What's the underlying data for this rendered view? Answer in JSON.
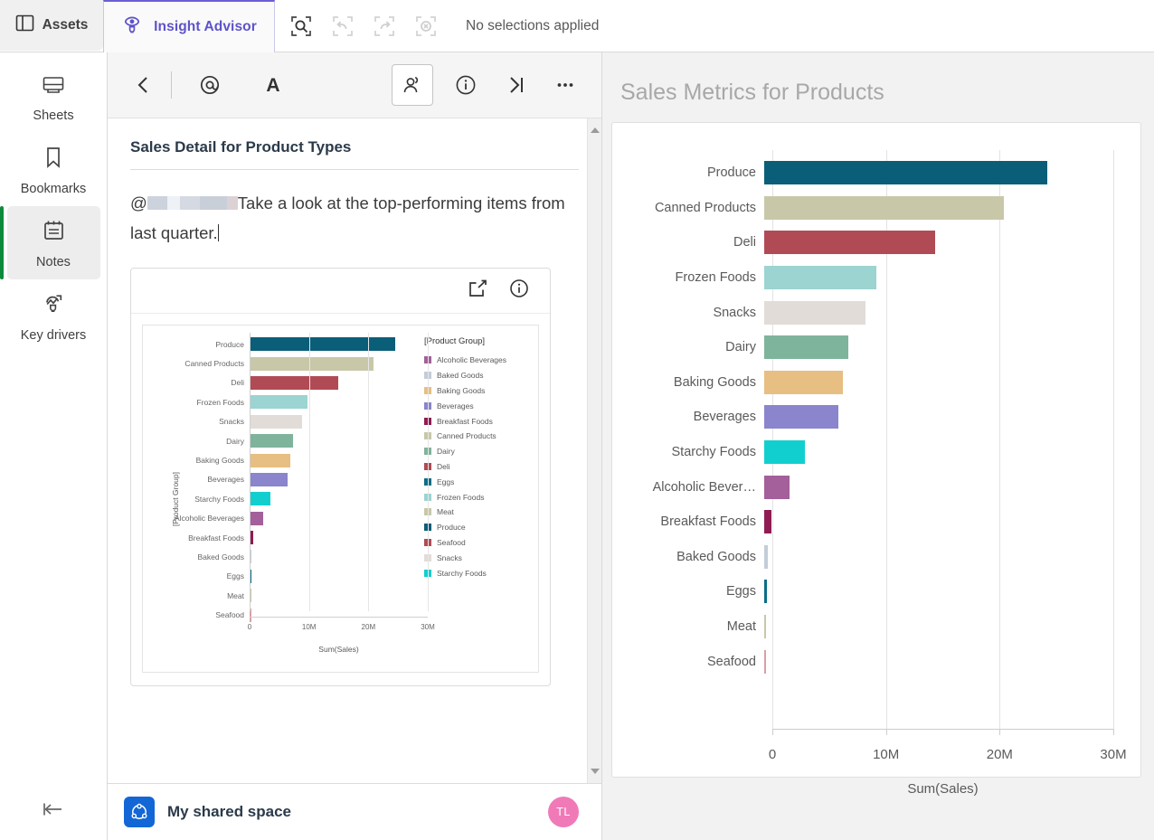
{
  "topbar": {
    "assets_label": "Assets",
    "assets_icon": "panel-icon",
    "insight_advisor_label": "Insight Advisor",
    "insight_advisor_icon": "lightbulb-eye-icon",
    "selection_search_icon": "selection-search-icon",
    "undo_icon": "undo-icon",
    "redo_icon": "redo-icon",
    "clear_icon": "clear-selections-icon",
    "selections_status": "No selections applied",
    "accent_color": "#5d53c9"
  },
  "sidebar": {
    "items": [
      {
        "label": "Sheets",
        "icon": "sheets-icon",
        "active": false
      },
      {
        "label": "Bookmarks",
        "icon": "bookmark-icon",
        "active": false
      },
      {
        "label": "Notes",
        "icon": "notes-icon",
        "active": true
      },
      {
        "label": "Key drivers",
        "icon": "key-drivers-icon",
        "active": false
      }
    ],
    "collapse_icon": "collapse-left-icon",
    "active_indicator_color": "#0d8a3c"
  },
  "notes": {
    "toolbar": {
      "back_icon": "chevron-left-icon",
      "mention_icon": "at-mention-icon",
      "mention_label": "@",
      "format_icon": "text-format-icon",
      "format_label": "A",
      "collaborators_icon": "collaborators-icon",
      "info_icon": "info-icon",
      "collapse_icon": "collapse-right-icon",
      "more_icon": "more-options-icon"
    },
    "title": "Sales Detail for Product Types",
    "body_mention_prefix": "@",
    "body_text": "Take a look at the top-performing items from last quarter.",
    "embed": {
      "share_icon": "share-export-icon",
      "info_icon": "info-icon"
    },
    "scrollbar": {
      "up_icon": "scroll-up-arrow",
      "down_icon": "scroll-down-arrow"
    },
    "footer": {
      "space_icon": "shared-space-icon",
      "space_name": "My shared space",
      "avatar_initials": "TL",
      "avatar_color": "#f07ab8"
    }
  },
  "main": {
    "title": "Sales Metrics for Products"
  },
  "chart_data": [
    {
      "id": "main-chart",
      "type": "bar",
      "orientation": "horizontal",
      "title": "Sales Metrics for Products",
      "xlabel": "Sum(Sales)",
      "ylabel": "",
      "xlim": [
        0,
        30000000
      ],
      "xticks": [
        0,
        10000000,
        20000000,
        30000000
      ],
      "xticklabels": [
        "0",
        "10M",
        "20M",
        "30M"
      ],
      "grid": true,
      "legend": "none",
      "categories": [
        "Produce",
        "Canned Products",
        "Deli",
        "Frozen Foods",
        "Snacks",
        "Dairy",
        "Baking Goods",
        "Beverages",
        "Starchy Foods",
        "Alcoholic Bever…",
        "Breakfast Foods",
        "Baked Goods",
        "Eggs",
        "Meat",
        "Seafood"
      ],
      "values": [
        24300000,
        20600000,
        14700000,
        9600000,
        8700000,
        7200000,
        6800000,
        6400000,
        3500000,
        2200000,
        600000,
        330000,
        260000,
        60000,
        50000
      ],
      "colors": [
        "#0a5e78",
        "#c8c8a9",
        "#b04b55",
        "#9bd4d1",
        "#e2dcd8",
        "#7fb49c",
        "#e7bf82",
        "#8a85cc",
        "#12cfcf",
        "#a3609a",
        "#8f1c52",
        "#c3cdd8",
        "#0a6e88",
        "#c8c8a9",
        "#d9a0a6"
      ]
    },
    {
      "id": "thumbnail-chart",
      "type": "bar",
      "orientation": "horizontal",
      "title": "",
      "xlabel": "Sum(Sales)",
      "ylabel": "[Product Group]",
      "xlim": [
        0,
        30000000
      ],
      "xticks": [
        0,
        10000000,
        20000000,
        30000000
      ],
      "xticklabels": [
        "0",
        "10M",
        "20M",
        "30M"
      ],
      "grid": true,
      "legend": "right",
      "legend_title": "[Product Group]",
      "categories": [
        "Produce",
        "Canned Products",
        "Deli",
        "Frozen Foods",
        "Snacks",
        "Dairy",
        "Baking Goods",
        "Beverages",
        "Starchy Foods",
        "Alcoholic Beverages",
        "Breakfast Foods",
        "Baked Goods",
        "Eggs",
        "Meat",
        "Seafood"
      ],
      "values": [
        24300000,
        20600000,
        14700000,
        9600000,
        8700000,
        7200000,
        6800000,
        6400000,
        3500000,
        2200000,
        600000,
        330000,
        260000,
        60000,
        50000
      ],
      "colors": [
        "#0a5e78",
        "#c8c8a9",
        "#b04b55",
        "#9bd4d1",
        "#e2dcd8",
        "#7fb49c",
        "#e7bf82",
        "#8a85cc",
        "#12cfcf",
        "#a3609a",
        "#8f1c52",
        "#c3cdd8",
        "#0a6e88",
        "#c8c8a9",
        "#d9a0a6"
      ],
      "legend_entries": [
        {
          "label": "Alcoholic Beverages",
          "color": "#a3609a"
        },
        {
          "label": "Baked Goods",
          "color": "#c3cdd8"
        },
        {
          "label": "Baking Goods",
          "color": "#e7bf82"
        },
        {
          "label": "Beverages",
          "color": "#8a85cc"
        },
        {
          "label": "Breakfast Foods",
          "color": "#8f1c52"
        },
        {
          "label": "Canned Products",
          "color": "#c8c8a9"
        },
        {
          "label": "Dairy",
          "color": "#7fb49c"
        },
        {
          "label": "Deli",
          "color": "#b04b55"
        },
        {
          "label": "Eggs",
          "color": "#0a6e88"
        },
        {
          "label": "Frozen Foods",
          "color": "#9bd4d1"
        },
        {
          "label": "Meat",
          "color": "#c8c8a9"
        },
        {
          "label": "Produce",
          "color": "#0a5e78"
        },
        {
          "label": "Seafood",
          "color": "#b04b55"
        },
        {
          "label": "Snacks",
          "color": "#e2dcd8"
        },
        {
          "label": "Starchy Foods",
          "color": "#12cfcf"
        }
      ]
    }
  ]
}
